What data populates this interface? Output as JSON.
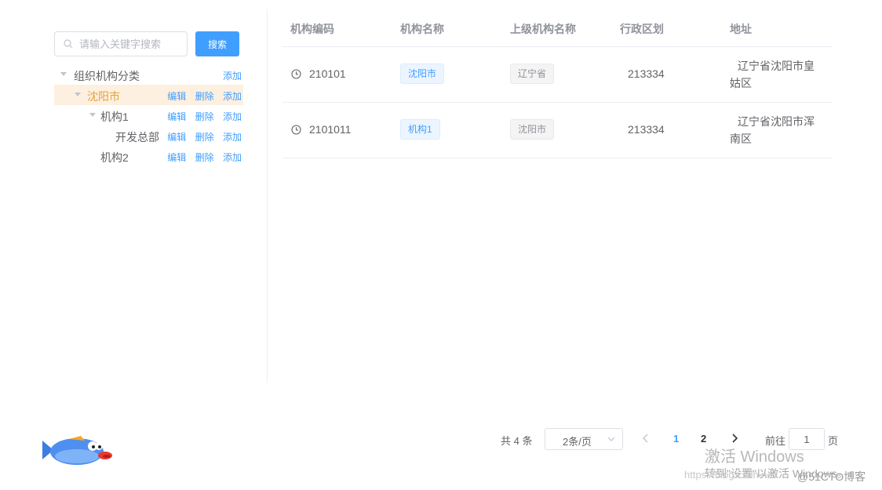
{
  "search": {
    "placeholder": "请输入关键字搜索",
    "button_label": "搜索"
  },
  "tree": {
    "nodes": [
      {
        "label": "组织机构分类",
        "actions": [
          "添加"
        ]
      },
      {
        "label": "沈阳市",
        "actions": [
          "编辑",
          "删除",
          "添加"
        ],
        "current": true
      },
      {
        "label": "机构1",
        "actions": [
          "编辑",
          "删除",
          "添加"
        ]
      },
      {
        "label": "开发总部",
        "actions": [
          "编辑",
          "删除",
          "添加"
        ]
      },
      {
        "label": "机构2",
        "actions": [
          "编辑",
          "删除",
          "添加"
        ]
      }
    ]
  },
  "table": {
    "columns": [
      "机构编码",
      "机构名称",
      "上级机构名称",
      "行政区划",
      "地址"
    ],
    "rows": [
      {
        "code": "210101",
        "name": "沈阳市",
        "parent": "辽宁省",
        "region": "213334",
        "address": "辽宁省沈阳市皇姑区"
      },
      {
        "code": "2101011",
        "name": "机构1",
        "parent": "沈阳市",
        "region": "213334",
        "address": "辽宁省沈阳市浑南区"
      }
    ]
  },
  "pagination": {
    "total_label": "共 4 条",
    "page_size": "2条/页",
    "pages": [
      "1",
      "2"
    ],
    "current_page": "1",
    "goto_label": "前往",
    "goto_value": "1",
    "page_suffix": "页"
  },
  "watermark": {
    "activate_title": "激活 Windows",
    "activate_sub": "转到\"设置\"以激活 Windows。",
    "blog_url": "https://blog.csdn.net",
    "blog_credit": "@51CTO博客"
  },
  "colors": {
    "primary": "#409eff",
    "current_node_bg": "#fdf0e0",
    "current_node_text": "#e6a23c"
  }
}
